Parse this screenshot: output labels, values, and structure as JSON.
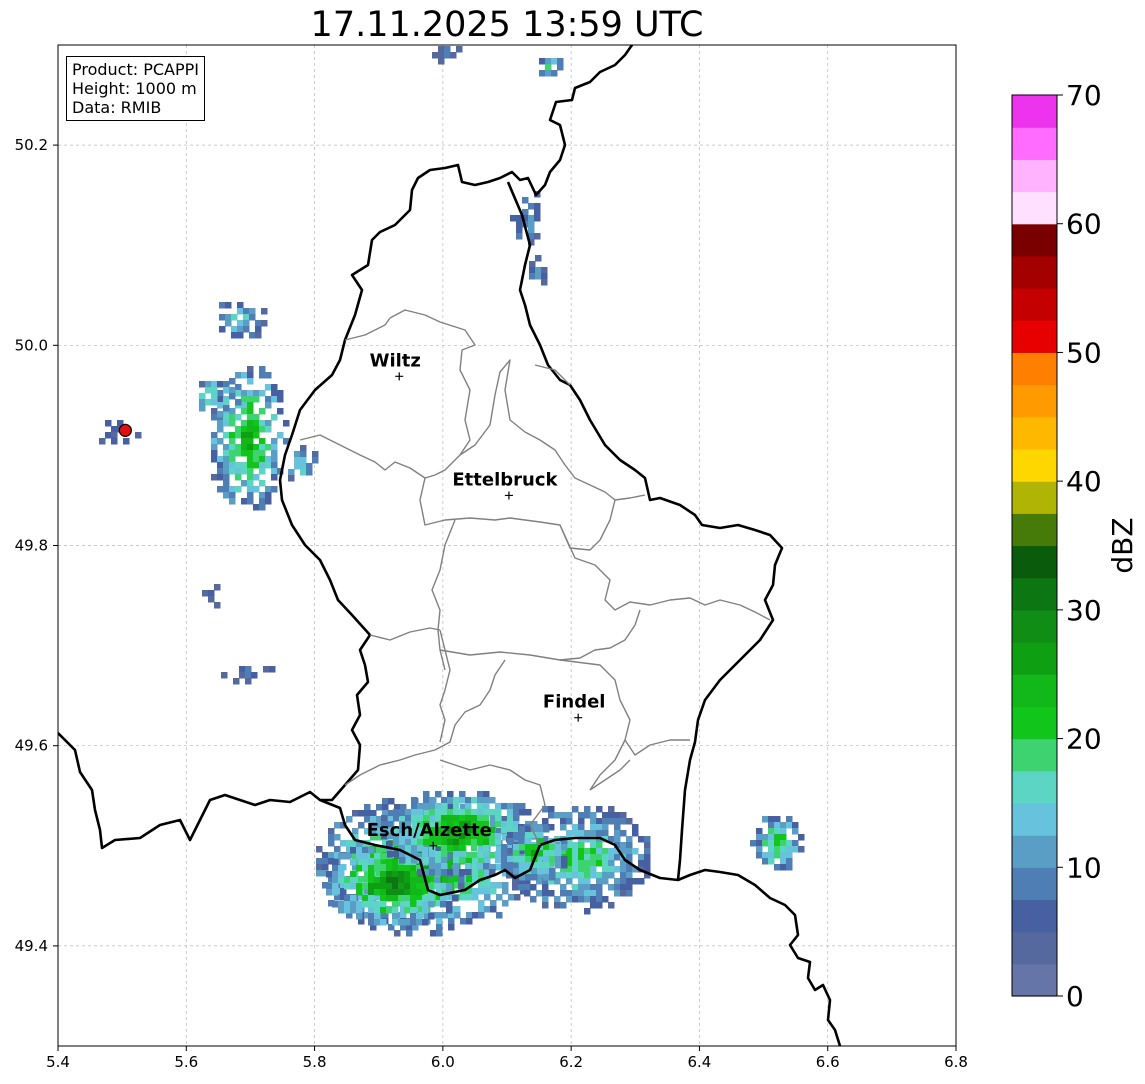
{
  "title": "17.11.2025 13:59 UTC",
  "info": {
    "product": "Product: PCAPPI",
    "height": "Height: 1000 m",
    "data": "Data: RMIB"
  },
  "map": {
    "lon_range": [
      5.4,
      6.8
    ],
    "lat_range": [
      49.3,
      50.3
    ],
    "x_ticks": [
      "5.4",
      "5.6",
      "5.8",
      "6.0",
      "6.2",
      "6.4",
      "6.6",
      "6.8"
    ],
    "y_ticks": [
      "49.4",
      "49.6",
      "49.8",
      "50.0",
      "50.2"
    ],
    "grid": true,
    "radar_site": {
      "lon": 5.505,
      "lat": 49.915
    },
    "cities": [
      {
        "name": "Wiltz",
        "lon": 5.932,
        "lat": 49.969
      },
      {
        "name": "Ettelbruck",
        "lon": 6.103,
        "lat": 49.85
      },
      {
        "name": "Findel",
        "lon": 6.211,
        "lat": 49.628
      },
      {
        "name": "Esch/Alzette",
        "lon": 5.985,
        "lat": 49.5
      }
    ]
  },
  "colorbar": {
    "label": "dBZ",
    "range": [
      0,
      70
    ],
    "ticks": [
      "0",
      "10",
      "20",
      "30",
      "40",
      "50",
      "60",
      "70"
    ],
    "colors": [
      "#6675a8",
      "#56699f",
      "#4660a2",
      "#4f7eb4",
      "#5a9ec6",
      "#66c2dd",
      "#5dd5c5",
      "#3dd371",
      "#11c51b",
      "#12b71a",
      "#0ea012",
      "#0f8d14",
      "#0c7612",
      "#0a5b0c",
      "#467b09",
      "#afb405",
      "#ffd700",
      "#ffb800",
      "#ff9a00",
      "#ff7f00",
      "#e60000",
      "#c40000",
      "#a50000",
      "#7a0000",
      "#ffe0ff",
      "#ffb3ff",
      "#ff6cff",
      "#ee33ee"
    ]
  }
}
